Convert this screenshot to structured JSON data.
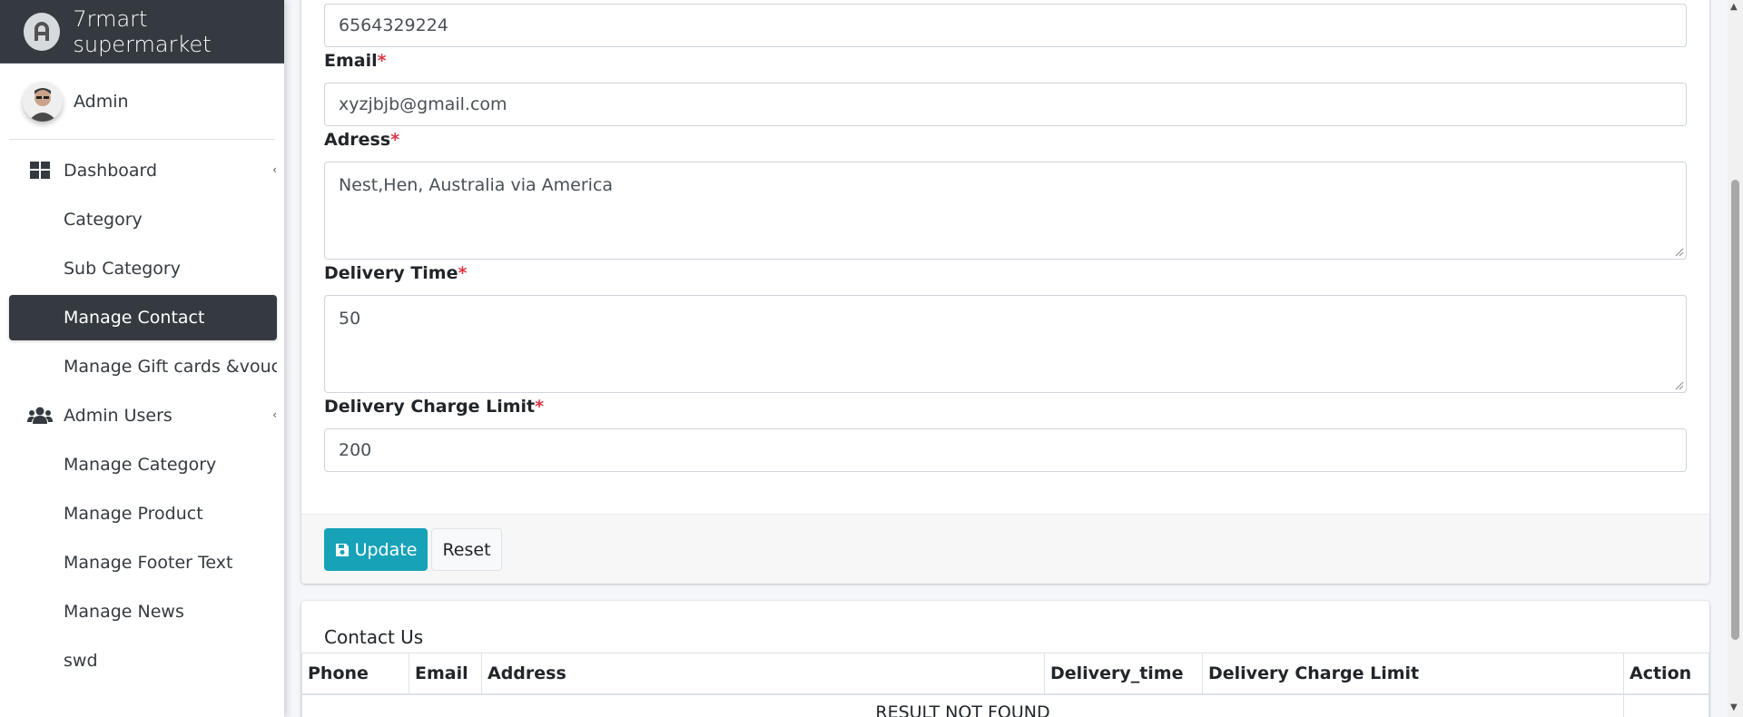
{
  "brand": {
    "name": "7rmart supermarket"
  },
  "user": {
    "name": "Admin"
  },
  "sidebar": {
    "items": [
      {
        "label": "Dashboard",
        "icon": "dashboard-icon",
        "parent": true
      },
      {
        "label": "Category"
      },
      {
        "label": "Sub Category"
      },
      {
        "label": "Manage Contact",
        "active": true
      },
      {
        "label": "Manage Gift cards &vouchers"
      },
      {
        "label": "Admin Users",
        "icon": "users-icon",
        "parent": true
      },
      {
        "label": "Manage Category"
      },
      {
        "label": "Manage Product"
      },
      {
        "label": "Manage Footer Text"
      },
      {
        "label": "Manage News"
      },
      {
        "label": "swd"
      }
    ],
    "arrow_glyph": "‹"
  },
  "form": {
    "phone_value": "6564329224",
    "email_label": "Email",
    "email_value": "xyzjbjb@gmail.com",
    "address_label": "Adress",
    "address_value": "Nest,Hen, Australia via America",
    "delivery_time_label": "Delivery Time",
    "delivery_time_value": "50",
    "delivery_charge_label": "Delivery Charge Limit",
    "delivery_charge_value": "200",
    "required_mark": "*",
    "update_label": "Update",
    "reset_label": "Reset"
  },
  "table": {
    "title": "Contact Us",
    "columns": [
      "Phone",
      "Email",
      "Address",
      "Delivery_time",
      "Delivery Charge Limit",
      "Action"
    ],
    "empty_text": "RESULT NOT FOUND"
  },
  "colors": {
    "brand_bg": "#343a40",
    "accent": "#17a2b8",
    "required": "#dc3545"
  }
}
